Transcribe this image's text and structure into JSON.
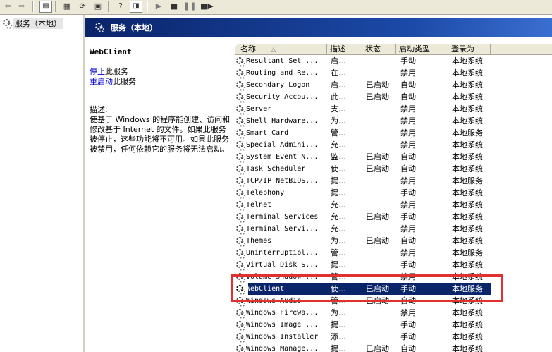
{
  "toolbar": {
    "buttons": [
      "back-icon",
      "forward-icon",
      "show-hide-tree-icon",
      "properties-icon",
      "refresh-icon",
      "export-list-icon",
      "help-icon",
      "show-console-icon",
      "start-icon",
      "stop-icon",
      "pause-icon",
      "restart-icon"
    ]
  },
  "tree": {
    "root_label": "服务（本地）"
  },
  "header": {
    "title": "服务（本地）"
  },
  "details": {
    "service_name": "WebClient",
    "stop_link": "停止",
    "stop_suffix": "此服务",
    "restart_link": "重启动",
    "restart_suffix": "此服务",
    "description_label": "描述:",
    "description_text": "使基于 Windows 的程序能创建、访问和修改基于 Internet 的文件。如果此服务被停止，这些功能将不可用。如果此服务被禁用，任何依赖它的服务将无法启动。"
  },
  "columns": {
    "name": "名称",
    "sort_arrow": "△",
    "desc": "描述",
    "status": "状态",
    "startup": "启动类型",
    "logon": "登录为"
  },
  "services": [
    {
      "name": "Resultant Set ...",
      "desc": "启...",
      "status": "",
      "startup": "手动",
      "logon": "本地系统"
    },
    {
      "name": "Routing and Re...",
      "desc": "在...",
      "status": "",
      "startup": "禁用",
      "logon": "本地系统"
    },
    {
      "name": "Secondary Logon",
      "desc": "启...",
      "status": "已启动",
      "startup": "自动",
      "logon": "本地系统"
    },
    {
      "name": "Security Accou...",
      "desc": "此...",
      "status": "已启动",
      "startup": "自动",
      "logon": "本地系统"
    },
    {
      "name": "Server",
      "desc": "支...",
      "status": "",
      "startup": "禁用",
      "logon": "本地系统"
    },
    {
      "name": "Shell Hardware...",
      "desc": "为...",
      "status": "",
      "startup": "禁用",
      "logon": "本地系统"
    },
    {
      "name": "Smart Card",
      "desc": "管...",
      "status": "",
      "startup": "禁用",
      "logon": "本地服务"
    },
    {
      "name": "Special Admini...",
      "desc": "允...",
      "status": "",
      "startup": "禁用",
      "logon": "本地系统"
    },
    {
      "name": "System Event N...",
      "desc": "监...",
      "status": "已启动",
      "startup": "自动",
      "logon": "本地系统"
    },
    {
      "name": "Task Scheduler",
      "desc": "使...",
      "status": "已启动",
      "startup": "自动",
      "logon": "本地系统"
    },
    {
      "name": "TCP/IP NetBIOS...",
      "desc": "提...",
      "status": "",
      "startup": "禁用",
      "logon": "本地服务"
    },
    {
      "name": "Telephony",
      "desc": "提...",
      "status": "",
      "startup": "手动",
      "logon": "本地系统"
    },
    {
      "name": "Telnet",
      "desc": "允...",
      "status": "",
      "startup": "禁用",
      "logon": "本地系统"
    },
    {
      "name": "Terminal Services",
      "desc": "允...",
      "status": "已启动",
      "startup": "手动",
      "logon": "本地系统"
    },
    {
      "name": "Terminal Servi...",
      "desc": "允...",
      "status": "",
      "startup": "禁用",
      "logon": "本地系统"
    },
    {
      "name": "Themes",
      "desc": "为...",
      "status": "已启动",
      "startup": "自动",
      "logon": "本地系统"
    },
    {
      "name": "Uninterruptibl...",
      "desc": "管...",
      "status": "",
      "startup": "禁用",
      "logon": "本地服务"
    },
    {
      "name": "Virtual Disk S...",
      "desc": "提...",
      "status": "",
      "startup": "手动",
      "logon": "本地系统"
    },
    {
      "name": "Volume Shadow ...",
      "desc": "管...",
      "status": "",
      "startup": "禁用",
      "logon": "本地系统"
    },
    {
      "name": "WebClient",
      "desc": "使...",
      "status": "已启动",
      "startup": "手动",
      "logon": "本地服务"
    },
    {
      "name": "Windows Audio",
      "desc": "管...",
      "status": "已启动",
      "startup": "自动",
      "logon": "本地系统"
    },
    {
      "name": "Windows Firewa...",
      "desc": "为...",
      "status": "",
      "startup": "禁用",
      "logon": "本地系统"
    },
    {
      "name": "Windows Image ...",
      "desc": "提...",
      "status": "",
      "startup": "手动",
      "logon": "本地系统"
    },
    {
      "name": "Windows Installer",
      "desc": "添...",
      "status": "",
      "startup": "手动",
      "logon": "本地系统"
    },
    {
      "name": "Windows Manage...",
      "desc": "提...",
      "status": "已启动",
      "startup": "自动",
      "logon": "本地系统"
    }
  ],
  "selected_service": "WebClient",
  "colors": {
    "header_blue": "#0a246a",
    "highlight_box": "#e03030",
    "link": "#0000cc"
  }
}
